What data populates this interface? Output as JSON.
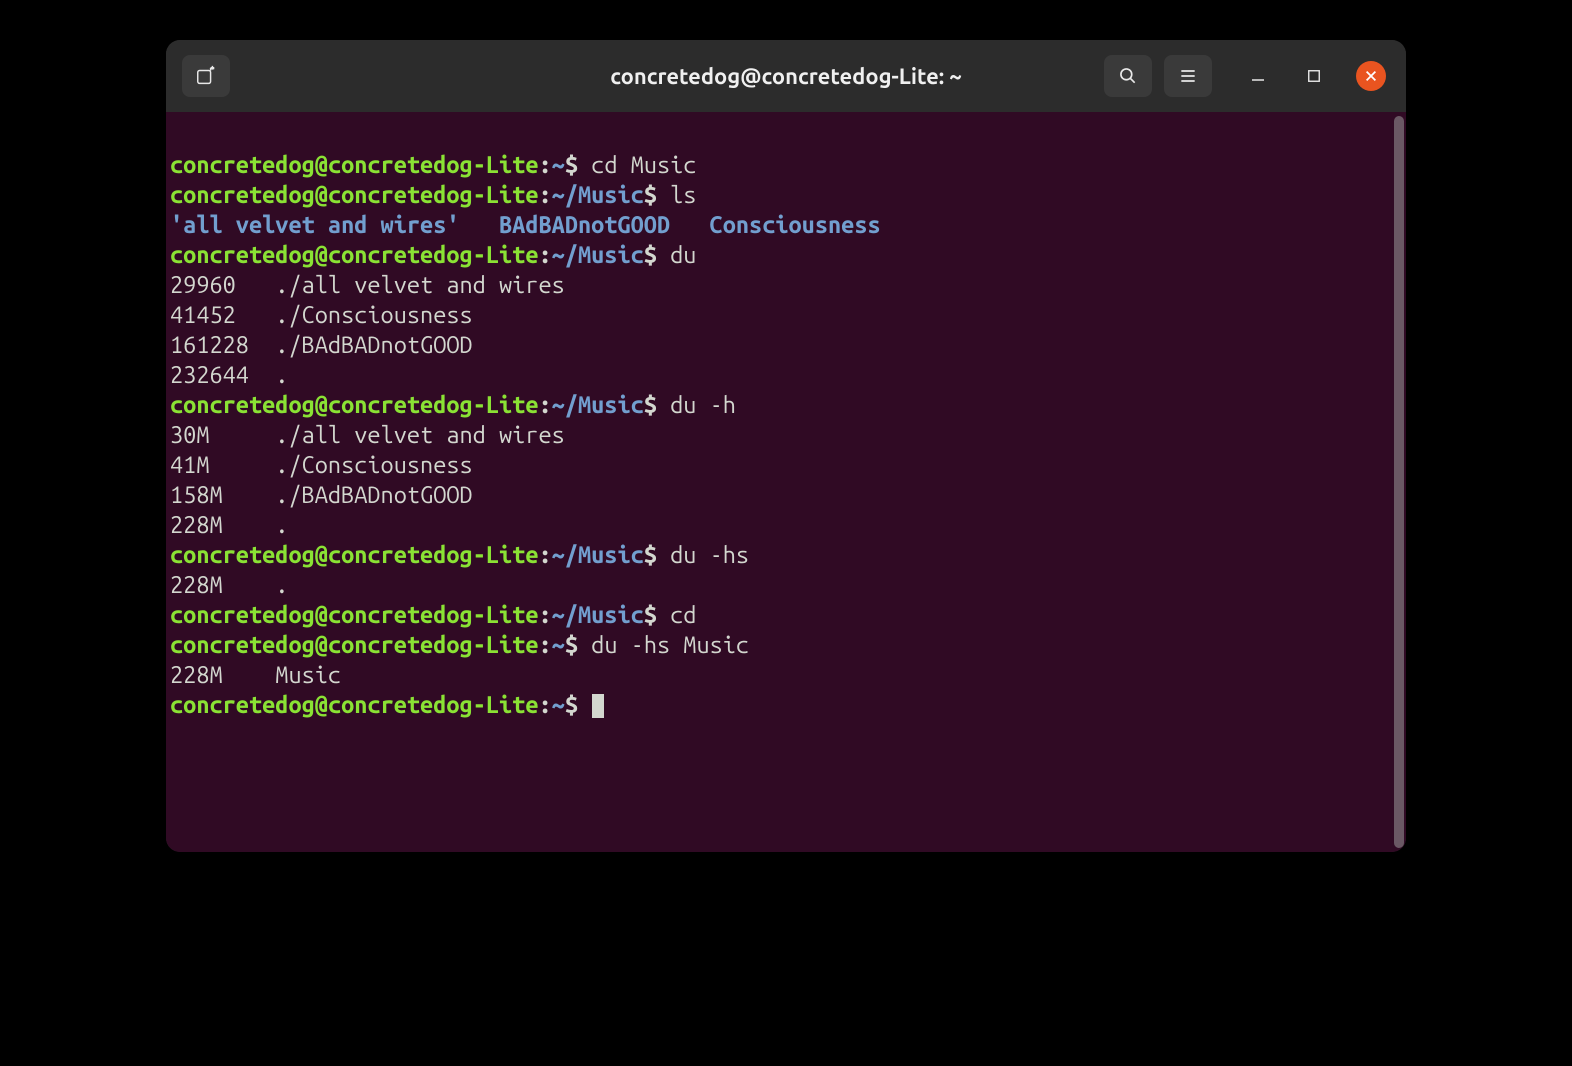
{
  "window": {
    "title": "concretedog@concretedog-Lite: ~"
  },
  "prompt": {
    "user": "concretedog",
    "at": "@",
    "host": "concretedog-Lite",
    "colon": ":",
    "home": "~",
    "music": "~/Music",
    "dollar": "$"
  },
  "lines": {
    "cmd1": " cd Music",
    "cmd2": " ls",
    "ls_out": "'all velvet and wires'   BAdBADnotGOOD   Consciousness",
    "cmd3": " du",
    "du1": "29960   ./all velvet and wires",
    "du2": "41452   ./Consciousness",
    "du3": "161228  ./BAdBADnotGOOD",
    "du4": "232644  .",
    "cmd4": " du -h",
    "duh1": "30M     ./all velvet and wires",
    "duh2": "41M     ./Consciousness",
    "duh3": "158M    ./BAdBADnotGOOD",
    "duh4": "228M    .",
    "cmd5": " du -hs",
    "duhs1": "228M    .",
    "cmd6": " cd",
    "cmd7": " du -hs Music",
    "duhsm1": "228M    Music"
  }
}
